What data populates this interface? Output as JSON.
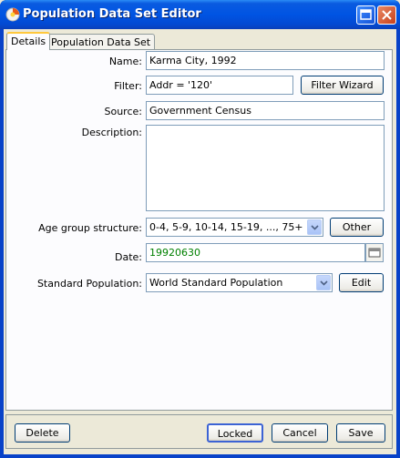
{
  "window": {
    "title": "Population Data Set Editor"
  },
  "tabs": [
    {
      "label": "Details"
    },
    {
      "label": "Population Data Set"
    }
  ],
  "form": {
    "name_label": "Name:",
    "name_value": "Karma City, 1992",
    "filter_label": "Filter:",
    "filter_value": "Addr = '120'",
    "filter_wizard_label": "Filter Wizard",
    "source_label": "Source:",
    "source_value": "Government Census",
    "description_label": "Description:",
    "description_value": "",
    "age_group_label": "Age group structure:",
    "age_group_value": "0-4, 5-9, 10-14, 15-19, ..., 75+",
    "other_label": "Other",
    "date_label": "Date:",
    "date_value": "19920630",
    "date_color": "#008000",
    "std_pop_label": "Standard Population:",
    "std_pop_value": "World Standard Population",
    "edit_label": "Edit"
  },
  "footer": {
    "delete_label": "Delete",
    "locked_label": "Locked",
    "cancel_label": "Cancel",
    "save_label": "Save"
  },
  "colors": {
    "titlebar": "#0054e3",
    "panel_bg": "#fcfcfe",
    "dialog_bg": "#ece9d8"
  }
}
